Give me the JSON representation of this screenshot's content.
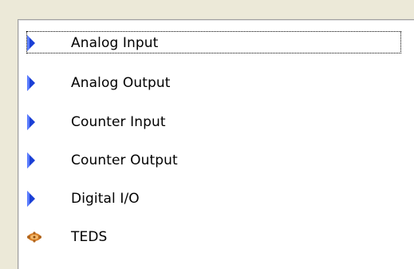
{
  "list": {
    "items": [
      {
        "label": "Analog Input",
        "icon": "blue-arrow-icon",
        "focused": true
      },
      {
        "label": "Analog Output",
        "icon": "blue-arrow-icon"
      },
      {
        "label": "Counter Input",
        "icon": "blue-arrow-icon"
      },
      {
        "label": "Counter Output",
        "icon": "blue-arrow-icon"
      },
      {
        "label": "Digital I/O",
        "icon": "blue-arrow-icon"
      },
      {
        "label": "TEDS",
        "icon": "teds-sensor-icon"
      }
    ]
  },
  "colors": {
    "arrow": "#1a3fd6",
    "teds": "#d9822b"
  }
}
